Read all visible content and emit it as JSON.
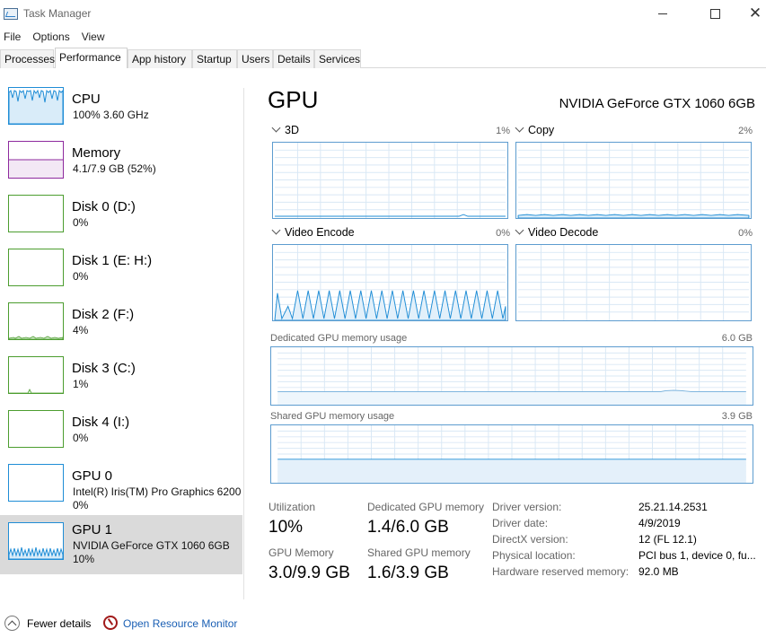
{
  "window": {
    "title": "Task Manager",
    "controls": [
      "minimize",
      "maximize",
      "close"
    ]
  },
  "menu": [
    "File",
    "Options",
    "View"
  ],
  "tabs": [
    {
      "label": "Processes",
      "active": false
    },
    {
      "label": "Performance",
      "active": true
    },
    {
      "label": "App history",
      "active": false
    },
    {
      "label": "Startup",
      "active": false
    },
    {
      "label": "Users",
      "active": false
    },
    {
      "label": "Details",
      "active": false
    },
    {
      "label": "Services",
      "active": false
    }
  ],
  "sidebar": {
    "items": [
      {
        "title": "CPU",
        "sub1": "100%  3.60 GHz",
        "sub2": "",
        "color": "#1f8dd6",
        "selected": false
      },
      {
        "title": "Memory",
        "sub1": "4.1/7.9 GB (52%)",
        "sub2": "",
        "color": "#8e2a9e",
        "selected": false
      },
      {
        "title": "Disk 0 (D:)",
        "sub1": "0%",
        "sub2": "",
        "color": "#4c9d2f",
        "selected": false
      },
      {
        "title": "Disk 1 (E: H:)",
        "sub1": "0%",
        "sub2": "",
        "color": "#4c9d2f",
        "selected": false
      },
      {
        "title": "Disk 2 (F:)",
        "sub1": "4%",
        "sub2": "",
        "color": "#4c9d2f",
        "selected": false
      },
      {
        "title": "Disk 3 (C:)",
        "sub1": "1%",
        "sub2": "",
        "color": "#4c9d2f",
        "selected": false
      },
      {
        "title": "Disk 4 (I:)",
        "sub1": "0%",
        "sub2": "",
        "color": "#4c9d2f",
        "selected": false
      },
      {
        "title": "GPU 0",
        "sub1": "Intel(R) Iris(TM) Pro Graphics 6200",
        "sub2": "0%",
        "color": "#1f8dd6",
        "selected": false
      },
      {
        "title": "GPU 1",
        "sub1": "NVIDIA GeForce GTX 1060 6GB",
        "sub2": "10%",
        "color": "#1f8dd6",
        "selected": true
      }
    ]
  },
  "main": {
    "title": "GPU",
    "device": "NVIDIA GeForce GTX 1060 6GB",
    "engines": [
      {
        "label": "3D",
        "pct": "1%"
      },
      {
        "label": "Copy",
        "pct": "2%"
      },
      {
        "label": "Video Encode",
        "pct": "0%"
      },
      {
        "label": "Video Decode",
        "pct": "0%"
      }
    ],
    "dedicated_mem": {
      "label": "Dedicated GPU memory usage",
      "max": "6.0 GB"
    },
    "shared_mem": {
      "label": "Shared GPU memory usage",
      "max": "3.9 GB"
    },
    "stats": {
      "utilization_label": "Utilization",
      "utilization_value": "10%",
      "dedicated_label": "Dedicated GPU memory",
      "dedicated_value": "1.4/6.0 GB",
      "gpu_memory_label": "GPU Memory",
      "gpu_memory_value": "3.0/9.9 GB",
      "shared_label": "Shared GPU memory",
      "shared_value": "1.6/3.9 GB"
    },
    "info": [
      {
        "label": "Driver version:",
        "value": "25.21.14.2531"
      },
      {
        "label": "Driver date:",
        "value": "4/9/2019"
      },
      {
        "label": "DirectX version:",
        "value": "12 (FL 12.1)"
      },
      {
        "label": "Physical location:",
        "value": "PCI bus 1, device 0, fu..."
      },
      {
        "label": "Hardware reserved memory:",
        "value": "92.0 MB"
      }
    ]
  },
  "footer": {
    "fewer_details": "Fewer details",
    "open_resource_monitor": "Open Resource Monitor"
  },
  "colors": {
    "accent_blue": "#1f8dd6",
    "graph_border": "#5d9ccf",
    "memory_purple": "#8e2a9e",
    "disk_green": "#4c9d2f",
    "link_blue": "#1a5fb4"
  }
}
